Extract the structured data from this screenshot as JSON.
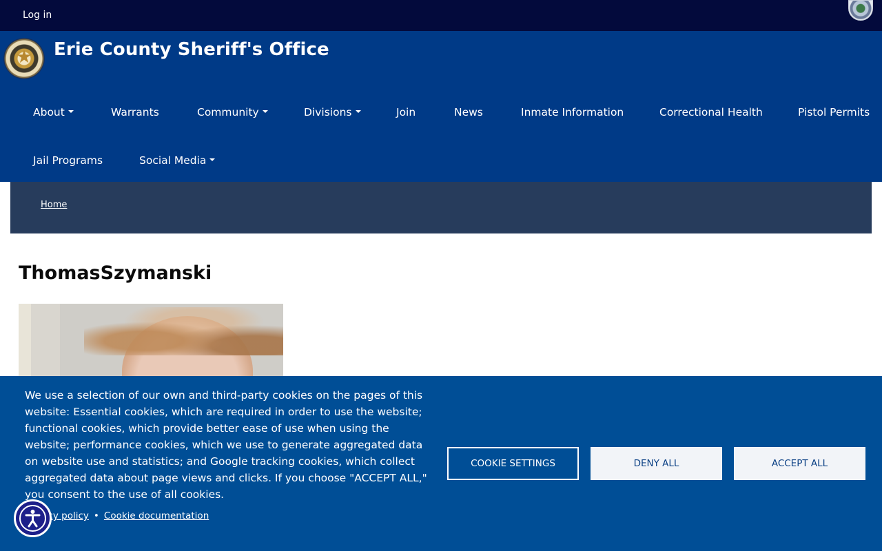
{
  "topbar": {
    "login_label": "Log in"
  },
  "header": {
    "site_title": "Erie County Sheriff's Office"
  },
  "nav": {
    "items": [
      {
        "label": "About",
        "has_dropdown": true
      },
      {
        "label": "Warrants",
        "has_dropdown": false
      },
      {
        "label": "Community",
        "has_dropdown": true
      },
      {
        "label": "Divisions",
        "has_dropdown": true
      },
      {
        "label": "Join",
        "has_dropdown": false
      },
      {
        "label": "News",
        "has_dropdown": false
      },
      {
        "label": "Inmate Information",
        "has_dropdown": false
      },
      {
        "label": "Correctional Health",
        "has_dropdown": false
      },
      {
        "label": "Pistol Permits",
        "has_dropdown": false
      },
      {
        "label": "Jail Programs",
        "has_dropdown": false
      },
      {
        "label": "Social Media",
        "has_dropdown": true
      }
    ]
  },
  "breadcrumb": {
    "home_label": "Home"
  },
  "page": {
    "title": "ThomasSzymanski"
  },
  "cookie": {
    "text": "We use a selection of our own and third-party cookies on the pages of this website: Essential cookies, which are required in order to use the website; functional cookies, which provide better ease of use when using the website; performance cookies, which we use to generate aggregated data on website use and statistics; and Google tracking cookies, which collect aggregated data about page views and clicks. If you choose \"ACCEPT ALL,\" you consent to the use of all cookies.",
    "privacy_label": "Privacy policy",
    "documentation_label": "Cookie documentation",
    "separator": "•",
    "settings_label": "COOKIE SETTINGS",
    "deny_label": "DENY ALL",
    "accept_label": "ACCEPT ALL"
  },
  "colors": {
    "topbar": "#030a3c",
    "header": "#003a87",
    "breadcrumb_bar": "#273c5c",
    "cookie_banner": "#004e96",
    "button_light": "#f2f4f8"
  },
  "icons": {
    "badge": "sheriff-star-badge-icon",
    "seal": "county-seal-icon",
    "dropdown": "caret-down-icon",
    "accessibility": "accessibility-icon"
  }
}
